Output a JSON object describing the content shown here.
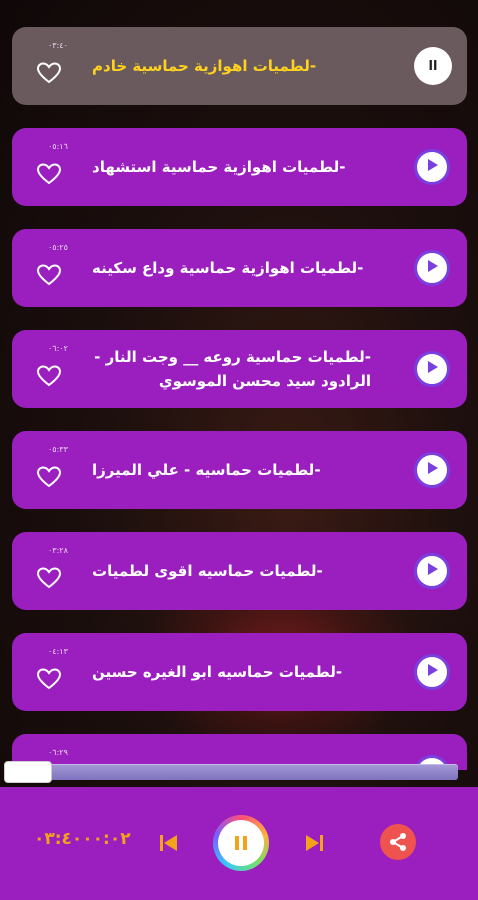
{
  "tracks": [
    {
      "title": "-لطميات اهوازية حماسية  خادم",
      "duration": "٠٣:٤٠",
      "active": true
    },
    {
      "title": "-لطميات اهوازية حماسية استشهاد",
      "duration": "٠٥:١٦",
      "active": false
    },
    {
      "title": "-لطميات اهوازية حماسية وداع سكينه",
      "duration": "٠٥:٢٥",
      "active": false
    },
    {
      "title": "-لطميات حماسية روعه __ وجت النار - الرادود سيد محسن الموسوي",
      "duration": "٠٦:٠٢",
      "active": false
    },
    {
      "title": "-لطميات حماسيه  - علي الميرزا",
      "duration": "٠٥:٣٣",
      "active": false
    },
    {
      "title": "-لطميات حماسيه  اقوى لطميات",
      "duration": "٠٣:٢٨",
      "active": false
    },
    {
      "title": "-لطميات حماسيه ابو الغيره حسين",
      "duration": "٠٤:١٣",
      "active": false
    },
    {
      "title": "",
      "duration": "٠٦:٢٩",
      "active": false
    }
  ],
  "active_indicator": "ll",
  "player": {
    "time": "٠٣:٤٠٠٠:٠٢",
    "icons": {
      "prev": "skip-previous-icon",
      "pause": "pause-icon",
      "next": "skip-next-icon",
      "share": "share-icon"
    }
  },
  "progress": {
    "fraction": 0.0
  },
  "colors": {
    "card": "#9b1fbe",
    "active_card": "#6a5a5e",
    "active_title": "#ffd21f",
    "time": "#f4a21a",
    "pause": "#f4a21a",
    "share": "#ef5350",
    "play_ring": "#7b3fe0"
  }
}
